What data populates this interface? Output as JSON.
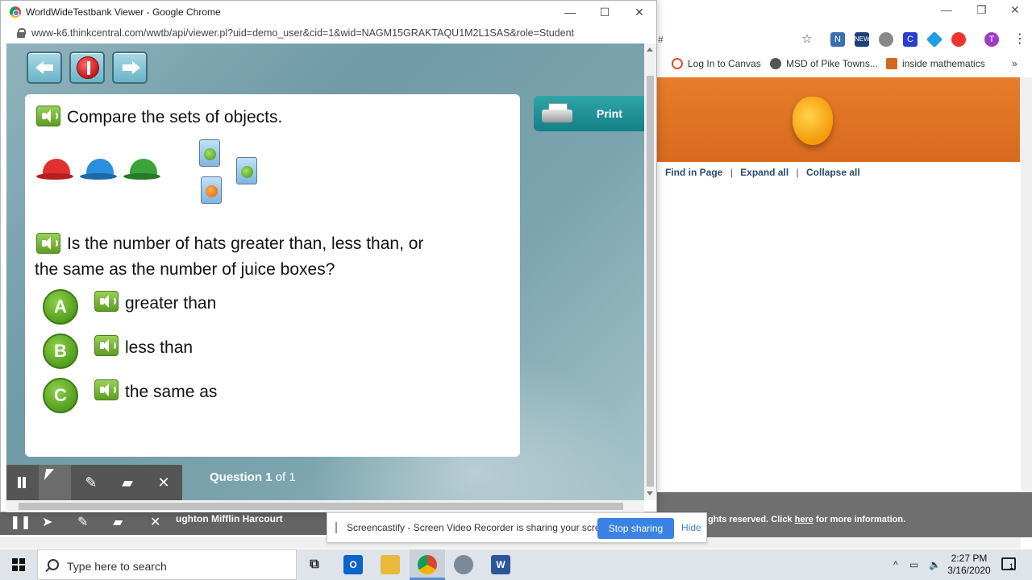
{
  "background_browser": {
    "address_tail": "#",
    "bookmarks": [
      {
        "label": "Log In to Canvas",
        "color": "#e44b2e"
      },
      {
        "label": "MSD of Pike Towns...",
        "color": "#555555"
      },
      {
        "label": "inside mathematics",
        "color": "#d2691e"
      }
    ],
    "profile_initial": "T",
    "links": {
      "find": "Find in Page",
      "sep1": "|",
      "expand": "Expand all",
      "sep2": "|",
      "collapse": "Collapse all"
    },
    "footer": {
      "prefix": "ghts reserved. Click ",
      "link": "here",
      "suffix": " for more information."
    },
    "publisher_fragment": "ughton Mifflin Harcourt"
  },
  "window": {
    "title": "WorldWideTestbank Viewer - Google Chrome",
    "url": "www-k6.thinkcentral.com/wwtb/api/viewer.pl?uid=demo_user&cid=1&wid=NAGM15GRAKTAQU1M2L1SAS&role=Student"
  },
  "question": {
    "prompt": "Compare the sets of objects.",
    "text": "Is the number of hats greater than, less than, or the same as the number of juice boxes?",
    "text_line1": "Is the number of hats greater than, less than, or",
    "text_line2": "the same as the number of juice boxes?",
    "hats": [
      "#e03030",
      "#2a8fdc",
      "#3aa33a"
    ],
    "options": [
      {
        "letter": "A",
        "label": "greater than"
      },
      {
        "letter": "B",
        "label": "less than"
      },
      {
        "letter": "C",
        "label": "the same as"
      }
    ]
  },
  "print_button": {
    "label": "Print"
  },
  "counter": {
    "prefix": "Question",
    "current": "1",
    "of": "of 1"
  },
  "screencastify": {
    "message": "Screencastify - Screen Video Recorder is sharing your screen.",
    "stop_label": "Stop sharing",
    "hide_label": "Hide"
  },
  "taskbar": {
    "search_placeholder": "Type here to search",
    "time": "2:27 PM",
    "date": "3/16/2020",
    "notification_count": "1"
  }
}
